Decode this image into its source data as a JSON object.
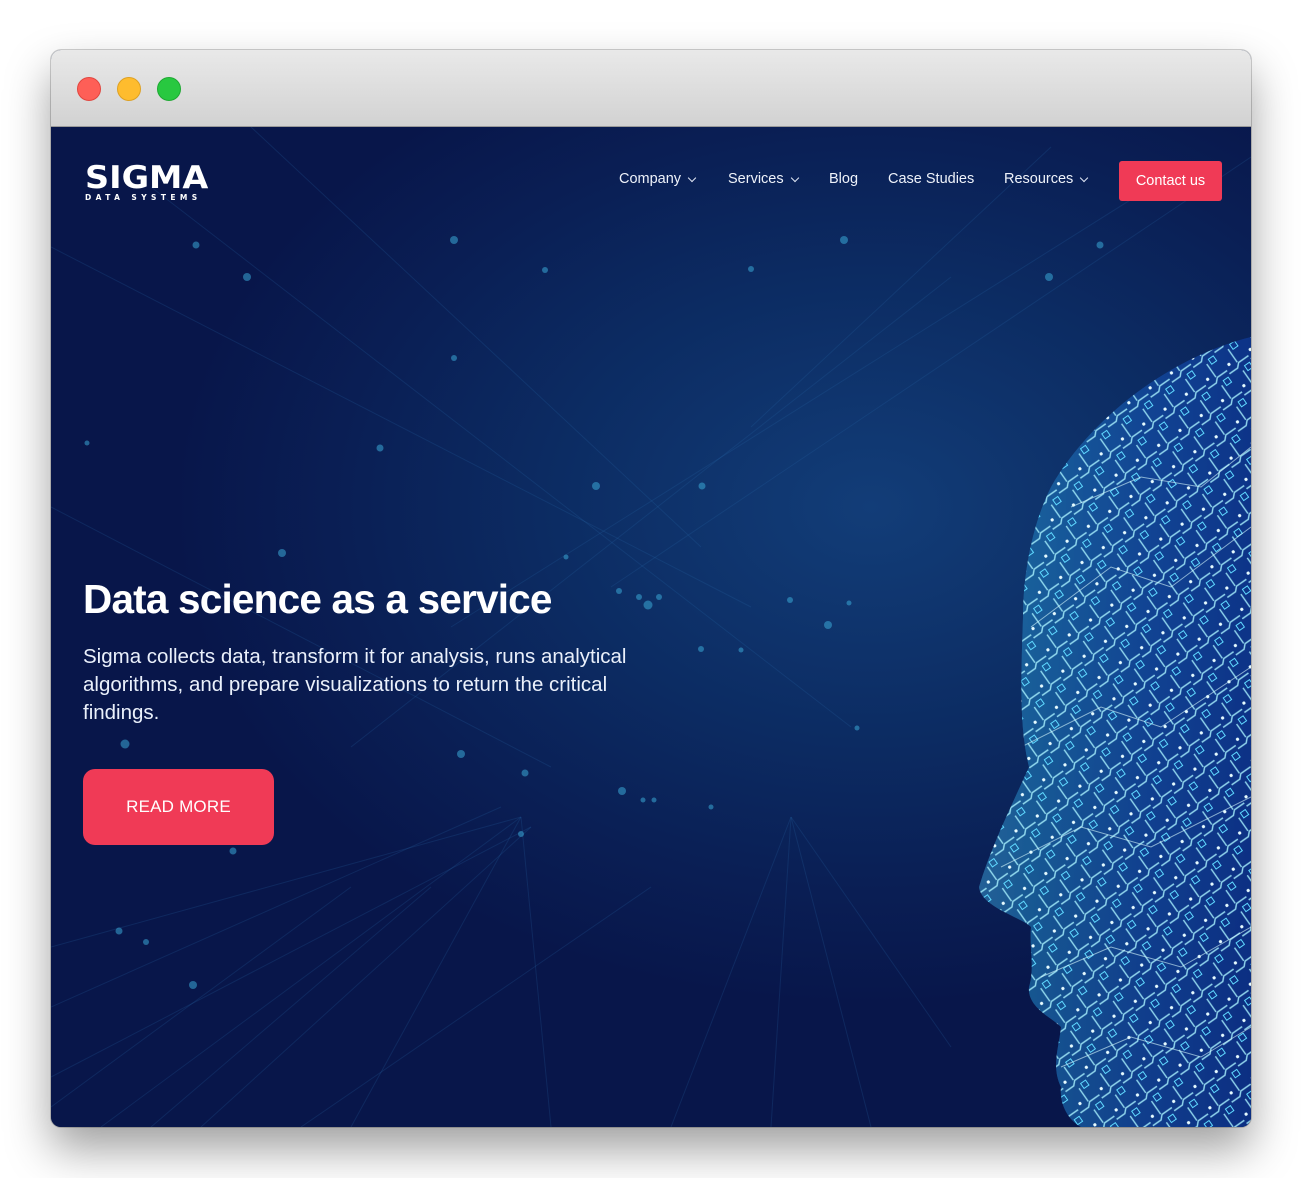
{
  "window": {
    "controls": [
      "close",
      "minimize",
      "maximize"
    ]
  },
  "brand": {
    "name": "SIGMA",
    "tagline": "DATA SYSTEMS"
  },
  "nav": {
    "items": [
      {
        "label": "Company",
        "has_dropdown": true
      },
      {
        "label": "Services",
        "has_dropdown": true
      },
      {
        "label": "Blog",
        "has_dropdown": false
      },
      {
        "label": "Case Studies",
        "has_dropdown": false
      },
      {
        "label": "Resources",
        "has_dropdown": true
      }
    ],
    "cta_label": "Contact us"
  },
  "hero": {
    "title": "Data science as a service",
    "description": "Sigma collects data, transform it for analysis, runs analytical algorithms, and prepare visualizations to return the critical findings.",
    "button_label": "READ MORE",
    "image": "digital-head-profile-illustration"
  },
  "colors": {
    "accent": "#f03a56",
    "background": "#0a1f55",
    "text": "#ffffff"
  }
}
